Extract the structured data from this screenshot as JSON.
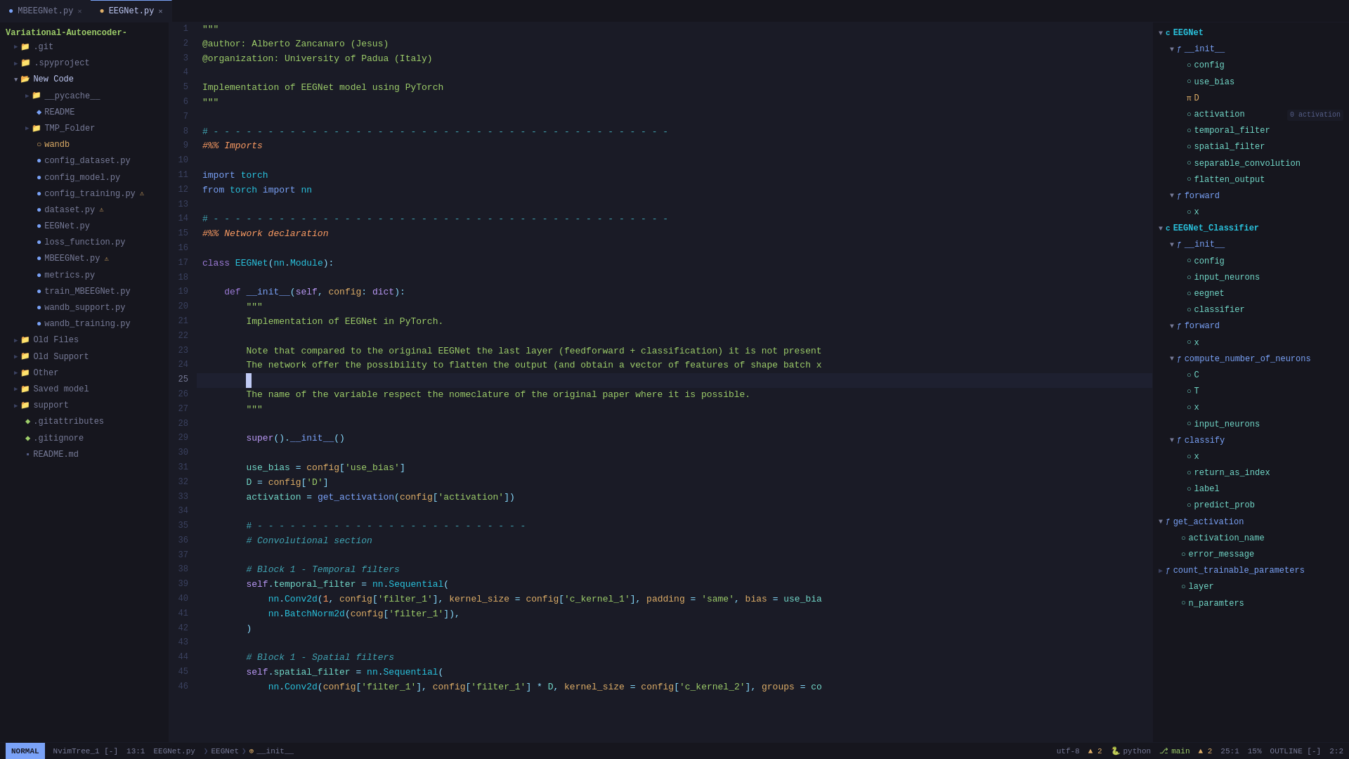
{
  "tabs": [
    {
      "id": "mbeeegnet",
      "label": "MBEEGNet.py",
      "active": false,
      "icon": "file-py"
    },
    {
      "id": "eegnet",
      "label": "EEGNet.py",
      "active": true,
      "icon": "file-py-yellow"
    }
  ],
  "sidebar": {
    "root": "Variational-Autoencoder-",
    "items": [
      {
        "id": "git",
        "label": ".git",
        "type": "folder",
        "indent": 1,
        "color": "blue"
      },
      {
        "id": "spyproject",
        "label": ".spyproject",
        "type": "folder",
        "indent": 1,
        "color": "purple"
      },
      {
        "id": "new_code",
        "label": "New Code",
        "type": "folder",
        "indent": 1,
        "color": "blue",
        "open": true
      },
      {
        "id": "pycache",
        "label": "__pycache__",
        "type": "folder",
        "indent": 2,
        "color": "blue"
      },
      {
        "id": "readme",
        "label": "README",
        "type": "file",
        "indent": 2,
        "color": "blue"
      },
      {
        "id": "tmp_folder",
        "label": "TMP_Folder",
        "type": "folder",
        "indent": 2,
        "color": "blue"
      },
      {
        "id": "wandb",
        "label": "wandb",
        "type": "file-circle",
        "indent": 2,
        "color": "yellow"
      },
      {
        "id": "config_dataset",
        "label": "config_dataset.py",
        "type": "file-py",
        "indent": 2,
        "color": "blue"
      },
      {
        "id": "config_model",
        "label": "config_model.py",
        "type": "file-py",
        "indent": 2,
        "color": "blue"
      },
      {
        "id": "config_training",
        "label": "config_training.py",
        "type": "file-py",
        "indent": 2,
        "color": "blue",
        "warning": true
      },
      {
        "id": "dataset",
        "label": "dataset.py",
        "type": "file-py",
        "indent": 2,
        "color": "blue",
        "warning": true
      },
      {
        "id": "eegnet",
        "label": "EEGNet.py",
        "type": "file-py",
        "indent": 2,
        "color": "blue"
      },
      {
        "id": "loss_function",
        "label": "loss_function.py",
        "type": "file-py",
        "indent": 2,
        "color": "blue"
      },
      {
        "id": "mbeeegnet",
        "label": "MBEEGNet.py",
        "type": "file-py",
        "indent": 2,
        "color": "blue",
        "warning2": true
      },
      {
        "id": "metrics",
        "label": "metrics.py",
        "type": "file-py",
        "indent": 2,
        "color": "blue"
      },
      {
        "id": "train_mbeeegnet",
        "label": "train_MBEEGNet.py",
        "type": "file-py",
        "indent": 2,
        "color": "blue"
      },
      {
        "id": "wandb_support",
        "label": "wandb_support.py",
        "type": "file-py",
        "indent": 2,
        "color": "blue"
      },
      {
        "id": "wandb_training",
        "label": "wandb_training.py",
        "type": "file-py",
        "indent": 2,
        "color": "blue"
      },
      {
        "id": "old_files",
        "label": "Old Files",
        "type": "folder",
        "indent": 1,
        "color": "blue"
      },
      {
        "id": "old_support",
        "label": "Old Support",
        "type": "folder",
        "indent": 1,
        "color": "blue"
      },
      {
        "id": "other",
        "label": "Other",
        "type": "folder",
        "indent": 1,
        "color": "blue"
      },
      {
        "id": "saved_model",
        "label": "Saved model",
        "type": "folder",
        "indent": 1,
        "color": "blue"
      },
      {
        "id": "support",
        "label": "support",
        "type": "folder",
        "indent": 1,
        "color": "blue"
      },
      {
        "id": "gitattributes",
        "label": ".gitattributes",
        "type": "file-dot",
        "indent": 1
      },
      {
        "id": "gitignore",
        "label": ".gitignore",
        "type": "file-dot",
        "indent": 1
      },
      {
        "id": "readme_md",
        "label": "README.md",
        "type": "file-readme",
        "indent": 1
      }
    ]
  },
  "code": {
    "lines": [
      {
        "num": 1,
        "content": "\"\"\""
      },
      {
        "num": 2,
        "content": "@author: Alberto Zancanaro (Jesus)"
      },
      {
        "num": 3,
        "content": "@organization: University of Padua (Italy)"
      },
      {
        "num": 4,
        "content": ""
      },
      {
        "num": 5,
        "content": "Implementation of EEGNet model using PyTorch"
      },
      {
        "num": 6,
        "content": "\"\"\""
      },
      {
        "num": 7,
        "content": ""
      },
      {
        "num": 8,
        "content": "# - - - - - - - - - - - - - - - - - - - - - - - - - - - - - - - - - - - - - - - - - -"
      },
      {
        "num": 9,
        "content": "#%% Imports"
      },
      {
        "num": 10,
        "content": ""
      },
      {
        "num": 11,
        "content": "import torch"
      },
      {
        "num": 12,
        "content": "from torch import nn"
      },
      {
        "num": 13,
        "content": ""
      },
      {
        "num": 14,
        "content": "# - - - - - - - - - - - - - - - - - - - - - - - - - - - - - - - - - - - - - - - - - -"
      },
      {
        "num": 15,
        "content": "#%% Network declaration"
      },
      {
        "num": 16,
        "content": ""
      },
      {
        "num": 17,
        "content": "class EEGNet(nn.Module):"
      },
      {
        "num": 18,
        "content": ""
      },
      {
        "num": 19,
        "content": "    def __init__(self, config: dict):"
      },
      {
        "num": 20,
        "content": "        \"\"\""
      },
      {
        "num": 21,
        "content": "        Implementation of EEGNet in PyTorch."
      },
      {
        "num": 22,
        "content": ""
      },
      {
        "num": 23,
        "content": "        Note that compared to the original EEGNet the last layer (feedforward + classification) it is not present"
      },
      {
        "num": 24,
        "content": "        The network offer the possibility to flatten the output (and obtain a vector of features of shape batch x"
      },
      {
        "num": 25,
        "content": "        ",
        "cursor": true
      },
      {
        "num": 26,
        "content": "        The name of the variable respect the nomeclature of the original paper where it is possible."
      },
      {
        "num": 27,
        "content": "        \"\"\""
      },
      {
        "num": 28,
        "content": ""
      },
      {
        "num": 29,
        "content": "        super().__init__()"
      },
      {
        "num": 30,
        "content": ""
      },
      {
        "num": 31,
        "content": "        use_bias = config['use_bias']"
      },
      {
        "num": 32,
        "content": "        D = config['D']"
      },
      {
        "num": 33,
        "content": "        activation = get_activation(config['activation'])"
      },
      {
        "num": 34,
        "content": ""
      },
      {
        "num": 35,
        "content": "        # - - - - - - - - - - - - - - - - - - - - - - - - -"
      },
      {
        "num": 36,
        "content": "        # Convolutional section"
      },
      {
        "num": 37,
        "content": ""
      },
      {
        "num": 38,
        "content": "        # Block 1 - Temporal filters"
      },
      {
        "num": 39,
        "content": "        self.temporal_filter = nn.Sequential("
      },
      {
        "num": 40,
        "content": "            nn.Conv2d(1, config['filter_1'], kernel_size = config['c_kernel_1'], padding = 'same', bias = use_bia"
      },
      {
        "num": 41,
        "content": "            nn.BatchNorm2d(config['filter_1']),"
      },
      {
        "num": 42,
        "content": "        )"
      },
      {
        "num": 43,
        "content": ""
      },
      {
        "num": 44,
        "content": "        # Block 1 - Spatial filters"
      },
      {
        "num": 45,
        "content": "        self.spatial_filter = nn.Sequential("
      },
      {
        "num": 46,
        "content": "            nn.Conv2d(config['filter_1'], config['filter_1'] * D, kernel_size = config['c_kernel_2'], groups = co"
      }
    ]
  },
  "outline": {
    "title": "EEGNet",
    "items": [
      {
        "id": "eegnet-class",
        "label": "EEGNet",
        "type": "class",
        "indent": 0,
        "open": true
      },
      {
        "id": "init1",
        "label": "__init__",
        "type": "fn",
        "indent": 1,
        "open": true
      },
      {
        "id": "config1",
        "label": "config",
        "type": "var",
        "indent": 2
      },
      {
        "id": "use_bias1",
        "label": "use_bias",
        "type": "var",
        "indent": 2
      },
      {
        "id": "D",
        "label": "D",
        "type": "pi",
        "indent": 2
      },
      {
        "id": "activation",
        "label": "activation",
        "type": "var",
        "indent": 2,
        "badge": "0 activation"
      },
      {
        "id": "temporal_filter",
        "label": "temporal_filter",
        "type": "var",
        "indent": 2
      },
      {
        "id": "spatial_filter",
        "label": "spatial_filter",
        "type": "var",
        "indent": 2
      },
      {
        "id": "separable_convolution",
        "label": "separable_convolution",
        "type": "var",
        "indent": 2
      },
      {
        "id": "flatten_output",
        "label": "flatten_output",
        "type": "var",
        "indent": 2
      },
      {
        "id": "forward1",
        "label": "forward",
        "type": "fn",
        "indent": 1,
        "open": true
      },
      {
        "id": "x1",
        "label": "x",
        "type": "var",
        "indent": 2
      },
      {
        "id": "eegnet-classifier",
        "label": "EEGNet_Classifier",
        "type": "class",
        "indent": 0,
        "open": true
      },
      {
        "id": "init2",
        "label": "__init__",
        "type": "fn",
        "indent": 1,
        "open": true
      },
      {
        "id": "config2",
        "label": "config",
        "type": "var",
        "indent": 2
      },
      {
        "id": "input_neurons1",
        "label": "input_neurons",
        "type": "var",
        "indent": 2
      },
      {
        "id": "eegnet-var",
        "label": "eegnet",
        "type": "var",
        "indent": 2
      },
      {
        "id": "classifier",
        "label": "classifier",
        "type": "var",
        "indent": 2
      },
      {
        "id": "forward2",
        "label": "forward",
        "type": "fn",
        "indent": 1,
        "open": true
      },
      {
        "id": "x2",
        "label": "x",
        "type": "var",
        "indent": 2
      },
      {
        "id": "compute_neurons",
        "label": "compute_number_of_neurons",
        "type": "fn",
        "indent": 1,
        "open": true
      },
      {
        "id": "C",
        "label": "C",
        "type": "var",
        "indent": 2
      },
      {
        "id": "T",
        "label": "T",
        "type": "var",
        "indent": 2
      },
      {
        "id": "x3",
        "label": "x",
        "type": "var",
        "indent": 2
      },
      {
        "id": "input_neurons2",
        "label": "input_neurons",
        "type": "var",
        "indent": 2
      },
      {
        "id": "classify",
        "label": "classify",
        "type": "fn",
        "indent": 1,
        "open": true
      },
      {
        "id": "x4",
        "label": "x",
        "type": "var",
        "indent": 2
      },
      {
        "id": "return_as_index",
        "label": "return_as_index",
        "type": "var",
        "indent": 2
      },
      {
        "id": "label",
        "label": "label",
        "type": "var",
        "indent": 2
      },
      {
        "id": "predict_prob",
        "label": "predict_prob",
        "type": "var",
        "indent": 2
      },
      {
        "id": "get_activation",
        "label": "get_activation",
        "type": "fn",
        "indent": 0,
        "open": true
      },
      {
        "id": "activation_name",
        "label": "activation_name",
        "type": "var",
        "indent": 1
      },
      {
        "id": "error_message",
        "label": "error_message",
        "type": "var",
        "indent": 1
      },
      {
        "id": "count_trainable",
        "label": "count_trainable_parameters",
        "type": "fn",
        "indent": 0
      },
      {
        "id": "layer",
        "label": "layer",
        "type": "var",
        "indent": 1
      },
      {
        "id": "n_params",
        "label": "n_paramters",
        "type": "var",
        "indent": 1
      }
    ]
  },
  "statusbar": {
    "tree": "NvimTree_1 [-]",
    "position": "13:1",
    "mode": "NORMAL",
    "filename": "EEGNet.py",
    "breadcrumb1": "EEGNet",
    "breadcrumb2": "__init__",
    "encoding": "utf-8",
    "warnings": "▲ 2",
    "filetype": "python",
    "branch": "main",
    "errors": "▲ 2",
    "cursor": "25:1",
    "scroll": "15%",
    "outline_label": "OUTLINE [-]",
    "line_col": "2:2"
  }
}
